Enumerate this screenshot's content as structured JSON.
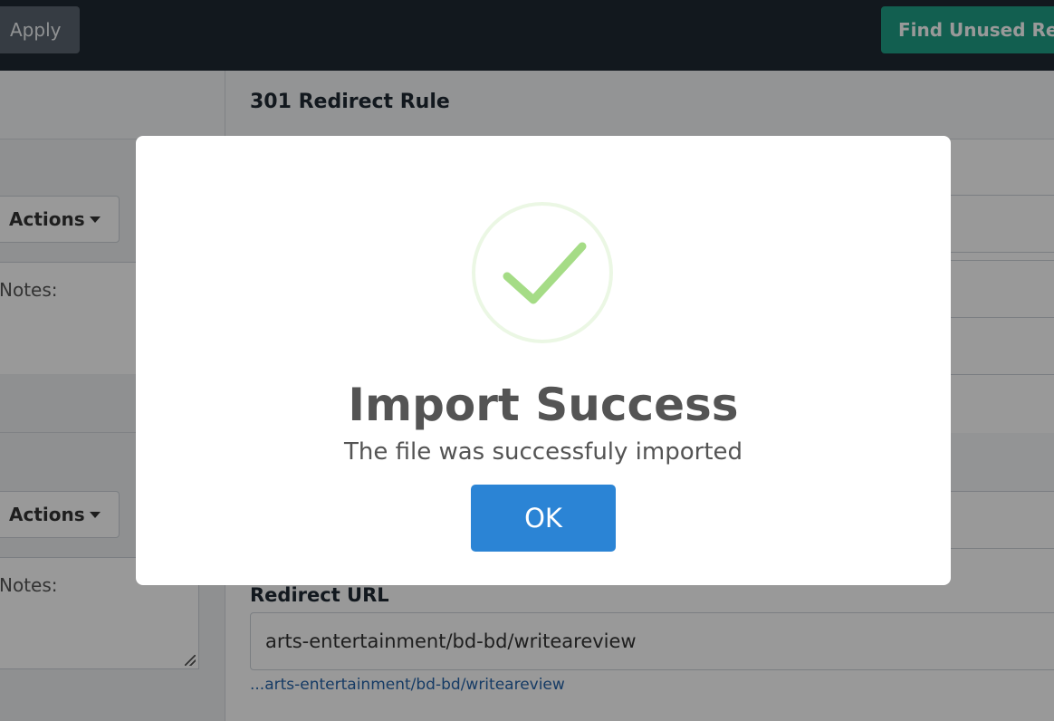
{
  "toolbar": {
    "apply_label": "Apply",
    "find_unused_label": "Find Unused Red"
  },
  "left_panel": {
    "rows": [
      {
        "actions_label": "Actions",
        "notes_label": "Notes:"
      },
      {
        "actions_label": "Actions",
        "notes_label": "Notes:"
      }
    ]
  },
  "main": {
    "rule_title": "301 Redirect Rule",
    "redirect_url_label": "Redirect URL",
    "redirect_url_value": "arts-entertainment/bd-bd/writeareview",
    "redirect_url_preview": "...arts-entertainment/bd-bd/writeareview"
  },
  "modal": {
    "icon": "checkmark-success-icon",
    "title": "Import Success",
    "text": "The file was successfuly imported",
    "ok_label": "OK"
  },
  "colors": {
    "topbar": "#1f2933",
    "accent_teal": "#1f9e85",
    "ok_button": "#2b84d5",
    "success_green": "#a5dc86",
    "link": "#2563a8"
  }
}
